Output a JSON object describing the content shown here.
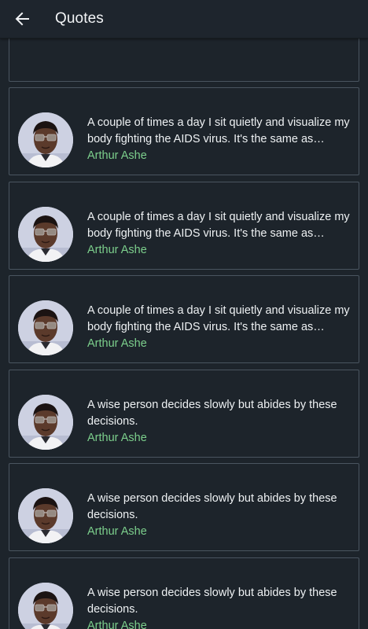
{
  "appbar": {
    "title": "Quotes",
    "back_icon": "arrow-left-icon"
  },
  "colors": {
    "background": "#1d242b",
    "card_border": "#4a5560",
    "author": "#7ccf8c",
    "text": "#eef1f3"
  },
  "quotes": [
    {
      "text": "A couple of times a day I sit quietly and visualize my body fighting the AIDS virus. It's the same as…",
      "author": "Arthur Ashe"
    },
    {
      "text": "A couple of times a day I sit quietly and visualize my body fighting the AIDS virus. It's the same as…",
      "author": "Arthur Ashe"
    },
    {
      "text": "A couple of times a day I sit quietly and visualize my body fighting the AIDS virus. It's the same as…",
      "author": "Arthur Ashe"
    },
    {
      "text": "A wise person decides slowly but abides by these decisions.",
      "author": "Arthur Ashe"
    },
    {
      "text": "A wise person decides slowly but abides by these decisions.",
      "author": "Arthur Ashe"
    },
    {
      "text": "A wise person decides slowly but abides by these decisions.",
      "author": "Arthur Ashe"
    }
  ]
}
